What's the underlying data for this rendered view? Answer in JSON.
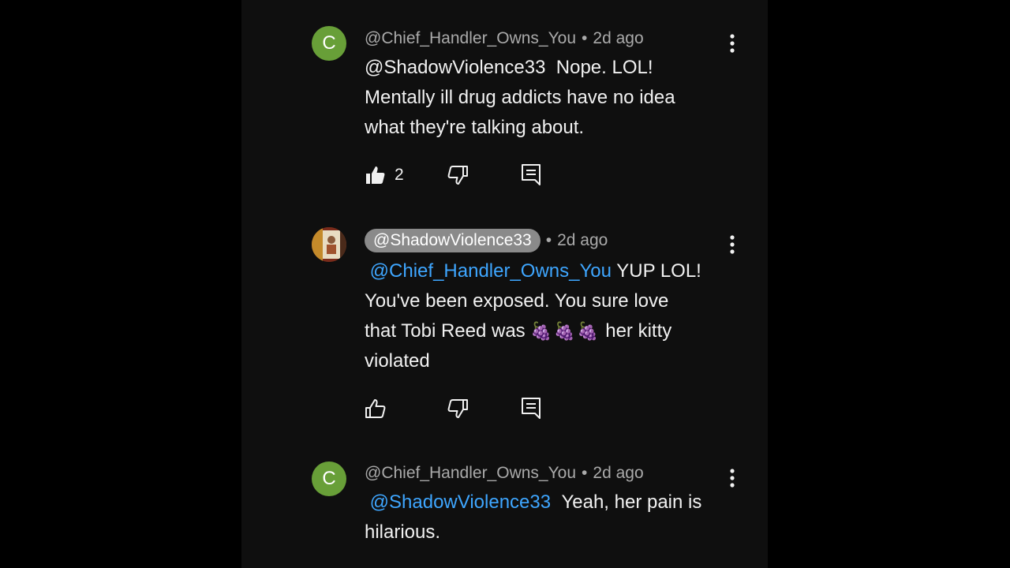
{
  "comments": [
    {
      "avatar_letter": "C",
      "avatar_color": "#689f38",
      "author": "@Chief_Handler_Owns_You",
      "separator": "•",
      "time": "2d ago",
      "line1_mention": "@ShadowViolence33",
      "line1_text": "Nope. LOL!",
      "line2": "Mentally ill drug addicts have no idea",
      "line3": "what they're talking about.",
      "like_count": "2",
      "like_icon": "thumbs-up-filled-icon",
      "dislike_icon": "thumbs-down-icon",
      "reply_icon": "reply-icon",
      "menu_icon": "kebab-menu-icon"
    },
    {
      "avatar_icon": "photo-avatar",
      "author": "@ShadowViolence33",
      "separator": "•",
      "time": "2d ago",
      "line1_mention": "@Chief_Handler_Owns_You",
      "line1_text": "YUP LOL!",
      "line2": "You've been exposed. You sure love",
      "line3_pre": "that Tobi Reed was",
      "line3_emoji": "🍇🍇🍇",
      "line3_post": "her kitty",
      "line4": "violated",
      "like_icon": "thumbs-up-outline-icon",
      "dislike_icon": "thumbs-down-icon",
      "reply_icon": "reply-icon",
      "menu_icon": "kebab-menu-icon"
    },
    {
      "avatar_letter": "C",
      "avatar_color": "#689f38",
      "author": "@Chief_Handler_Owns_You",
      "separator": "•",
      "time": "2d ago",
      "line1_mention": "@ShadowViolence33",
      "line1_text": "Yeah, her pain is",
      "line2": "hilarious.",
      "menu_icon": "kebab-menu-icon"
    }
  ],
  "colors": {
    "background": "#0f0f0f",
    "mention": "#3ea6ff",
    "author_chip": "#8a8a8a",
    "text": "#f1f1f1",
    "meta": "#aaaaaa"
  }
}
